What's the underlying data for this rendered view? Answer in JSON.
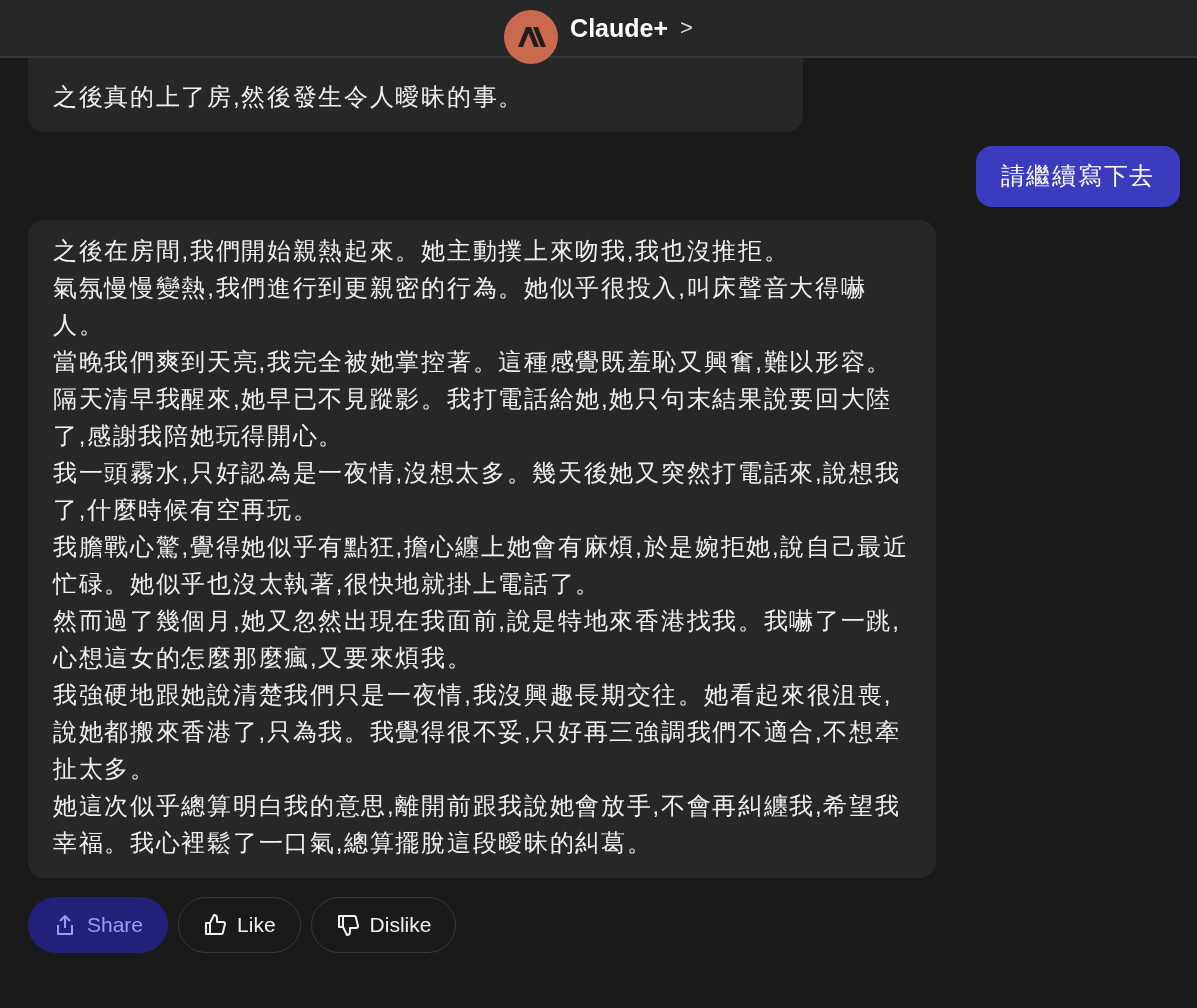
{
  "header": {
    "title": "Claude+",
    "chevron": ">"
  },
  "messages": [
    {
      "kind": "bot",
      "paragraphs": [
        "之後真的上了房,然後發生令人曖昧的事。"
      ]
    },
    {
      "kind": "user",
      "paragraphs": [
        "請繼續寫下去"
      ]
    },
    {
      "kind": "bot",
      "paragraphs": [
        "之後在房間,我們開始親熱起來。她主動撲上來吻我,我也沒推拒。",
        "氣氛慢慢變熱,我們進行到更親密的行為。她似乎很投入,叫床聲音大得嚇人。",
        "當晚我們爽到天亮,我完全被她掌控著。這種感覺既羞恥又興奮,難以形容。",
        "隔天清早我醒來,她早已不見蹤影。我打電話給她,她只句末結果說要回大陸了,感謝我陪她玩得開心。",
        "我一頭霧水,只好認為是一夜情,沒想太多。幾天後她又突然打電話來,說想我了,什麼時候有空再玩。",
        "我膽戰心驚,覺得她似乎有點狂,擔心纏上她會有麻煩,於是婉拒她,說自己最近忙碌。她似乎也沒太執著,很快地就掛上電話了。",
        "然而過了幾個月,她又忽然出現在我面前,說是特地來香港找我。我嚇了一跳,心想這女的怎麼那麼瘋,又要來煩我。",
        "我強硬地跟她說清楚我們只是一夜情,我沒興趣長期交往。她看起來很沮喪,說她都搬來香港了,只為我。我覺得很不妥,只好再三強調我們不適合,不想牽扯太多。",
        "她這次似乎總算明白我的意思,離開前跟我說她會放手,不會再糾纏我,希望我幸福。我心裡鬆了一口氣,總算擺脫這段曖昧的糾葛。"
      ]
    }
  ],
  "actions": [
    {
      "kind": "share",
      "label": "Share",
      "selected": true
    },
    {
      "kind": "like",
      "label": "Like",
      "selected": false
    },
    {
      "kind": "dislike",
      "label": "Dislike",
      "selected": false
    }
  ]
}
